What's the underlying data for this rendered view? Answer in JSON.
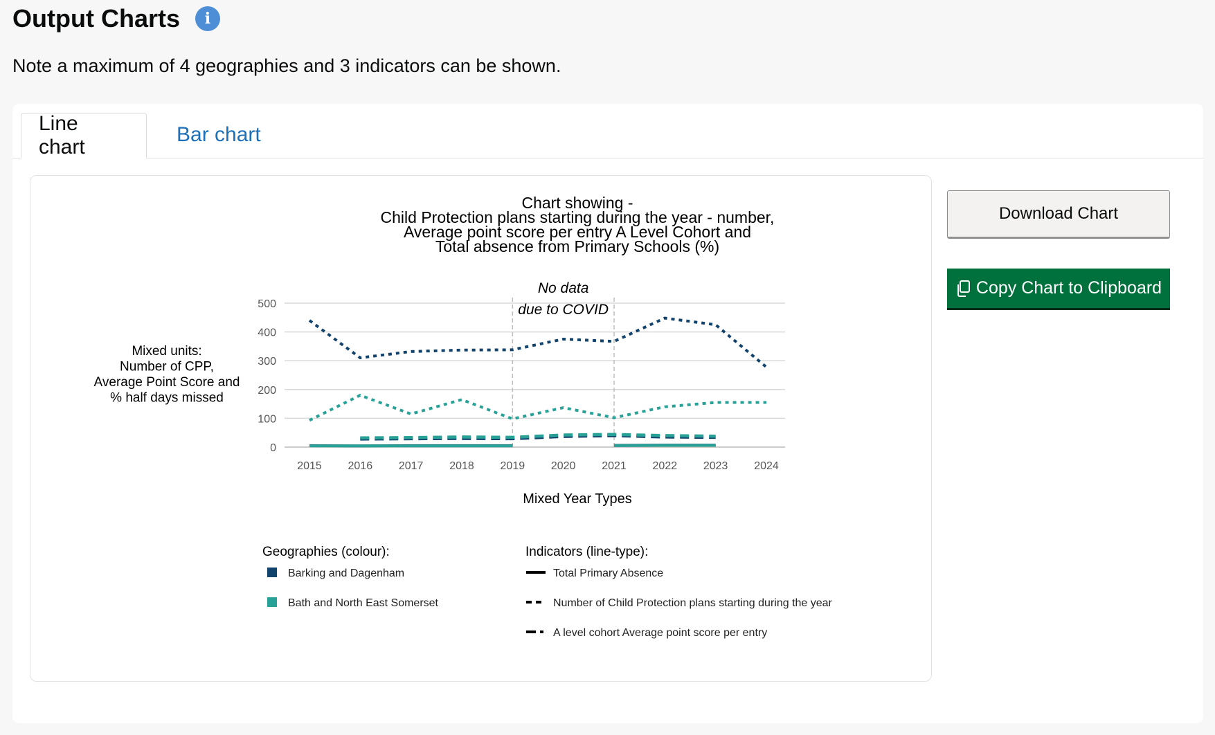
{
  "page": {
    "title": "Output Charts",
    "note": "Note a maximum of 4 geographies and 3 indicators can be shown."
  },
  "icons": {
    "info": "info-icon",
    "copy": "copy-icon"
  },
  "tabs": [
    {
      "label": "Line chart",
      "active": true
    },
    {
      "label": "Bar chart",
      "active": false
    }
  ],
  "buttons": {
    "download": "Download Chart",
    "copy": "Copy Chart to Clipboard"
  },
  "colors": {
    "barking": "#12436d",
    "bath": "#28a197",
    "primary_button": "#00703c",
    "link": "#1d70b8"
  },
  "chart_data": {
    "type": "line",
    "title_lines": [
      "Chart showing -",
      "Child Protection plans starting during the year - number,",
      "Average point score per entry A Level Cohort and",
      "Total absence from Primary Schools (%)"
    ],
    "ylabel_lines": [
      "Mixed units:",
      "Number of CPP,",
      "Average Point Score and",
      "% half days missed"
    ],
    "xlabel": "Mixed Year Types",
    "x": [
      2015,
      2016,
      2017,
      2018,
      2019,
      2020,
      2021,
      2022,
      2023,
      2024
    ],
    "ylim": [
      0,
      500
    ],
    "yticks": [
      0,
      100,
      200,
      300,
      400,
      500
    ],
    "grid": true,
    "annotation": {
      "lines": [
        "No data",
        "due to COVID"
      ],
      "x_start": 2019,
      "x_end": 2021
    },
    "legend": {
      "geographies_title": "Geographies (colour):",
      "indicators_title": "Indicators (line-type):",
      "geographies": [
        {
          "name": "Barking and Dagenham",
          "color": "#12436d"
        },
        {
          "name": "Bath and North East Somerset",
          "color": "#28a197"
        }
      ],
      "indicators": [
        {
          "name": "Total Primary Absence",
          "dash": "solid"
        },
        {
          "name": "Number of Child Protection plans starting during the year",
          "dash": "dotted"
        },
        {
          "name": "A level cohort Average point score per entry",
          "dash": "dashed"
        }
      ]
    },
    "series": [
      {
        "geography": "Barking and Dagenham",
        "indicator": "Number of Child Protection plans starting during the year",
        "color": "#12436d",
        "dash": "dotted",
        "x": [
          2015,
          2016,
          2017,
          2018,
          2019,
          2020,
          2021,
          2022,
          2023,
          2024
        ],
        "values": [
          440,
          310,
          332,
          337,
          338,
          375,
          367,
          448,
          425,
          278
        ]
      },
      {
        "geography": "Bath and North East Somerset",
        "indicator": "Number of Child Protection plans starting during the year",
        "color": "#28a197",
        "dash": "dotted",
        "x": [
          2015,
          2016,
          2017,
          2018,
          2019,
          2020,
          2021,
          2022,
          2023,
          2024
        ],
        "values": [
          93,
          180,
          115,
          165,
          98,
          137,
          102,
          140,
          155,
          155
        ]
      },
      {
        "geography": "Barking and Dagenham",
        "indicator": "A level cohort Average point score per entry",
        "color": "#12436d",
        "dash": "dashed",
        "x": [
          2016,
          2017,
          2018,
          2019,
          2020,
          2021,
          2022,
          2023
        ],
        "values": [
          28,
          29,
          30,
          29,
          37,
          40,
          35,
          34
        ]
      },
      {
        "geography": "Bath and North East Somerset",
        "indicator": "A level cohort Average point score per entry",
        "color": "#28a197",
        "dash": "dashed",
        "x": [
          2016,
          2017,
          2018,
          2019,
          2020,
          2021,
          2022,
          2023
        ],
        "values": [
          32,
          33,
          35,
          34,
          42,
          44,
          40,
          38
        ]
      },
      {
        "geography": "Barking and Dagenham",
        "indicator": "Total Primary Absence",
        "color": "#12436d",
        "dash": "solid",
        "x": [
          2015,
          2016,
          2017,
          2018,
          2019
        ],
        "values": [
          5,
          4,
          5,
          5,
          5
        ]
      },
      {
        "geography": "Barking and Dagenham",
        "indicator": "Total Primary Absence",
        "color": "#12436d",
        "dash": "solid",
        "x": [
          2021,
          2022,
          2023
        ],
        "values": [
          6,
          7,
          7
        ]
      },
      {
        "geography": "Bath and North East Somerset",
        "indicator": "Total Primary Absence",
        "color": "#28a197",
        "dash": "solid",
        "x": [
          2015,
          2016,
          2017,
          2018,
          2019
        ],
        "values": [
          4,
          4,
          4,
          4,
          4
        ]
      },
      {
        "geography": "Bath and North East Somerset",
        "indicator": "Total Primary Absence",
        "color": "#28a197",
        "dash": "solid",
        "x": [
          2021,
          2022,
          2023
        ],
        "values": [
          5,
          6,
          6
        ]
      }
    ]
  }
}
